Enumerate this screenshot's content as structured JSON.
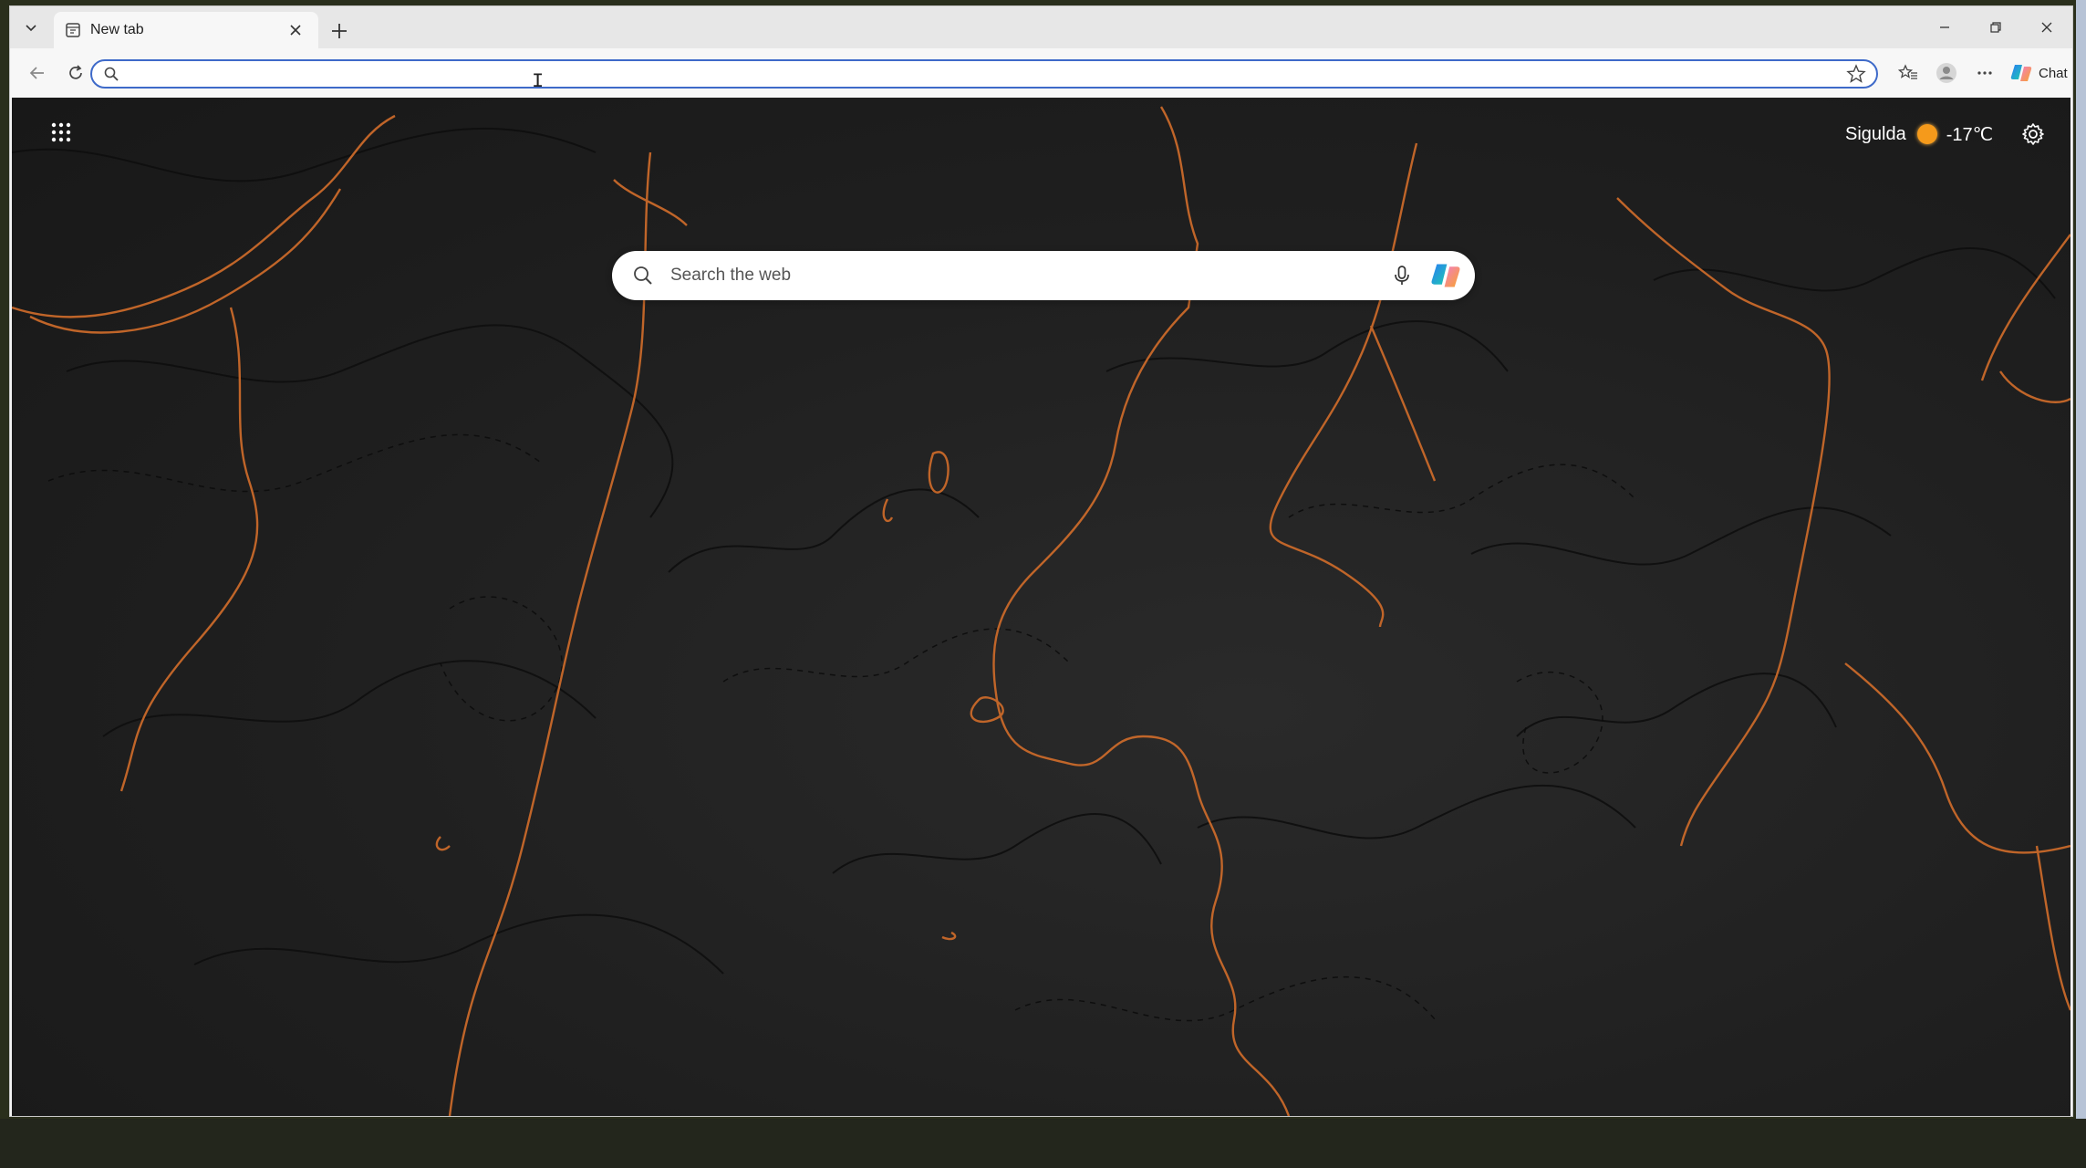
{
  "browser": {
    "tab": {
      "title": "New tab"
    },
    "address_bar": {
      "value": "",
      "placeholder": ""
    },
    "copilot": {
      "label": "Chat"
    }
  },
  "new_tab_page": {
    "weather": {
      "city": "Sigulda",
      "temperature": "-17℃",
      "icon": "sun-icon"
    },
    "search": {
      "placeholder": "Search the web"
    },
    "colors": {
      "accent": "#e07b2e",
      "background": "#1e1e1e",
      "address_border": "#3e6ac9"
    }
  }
}
